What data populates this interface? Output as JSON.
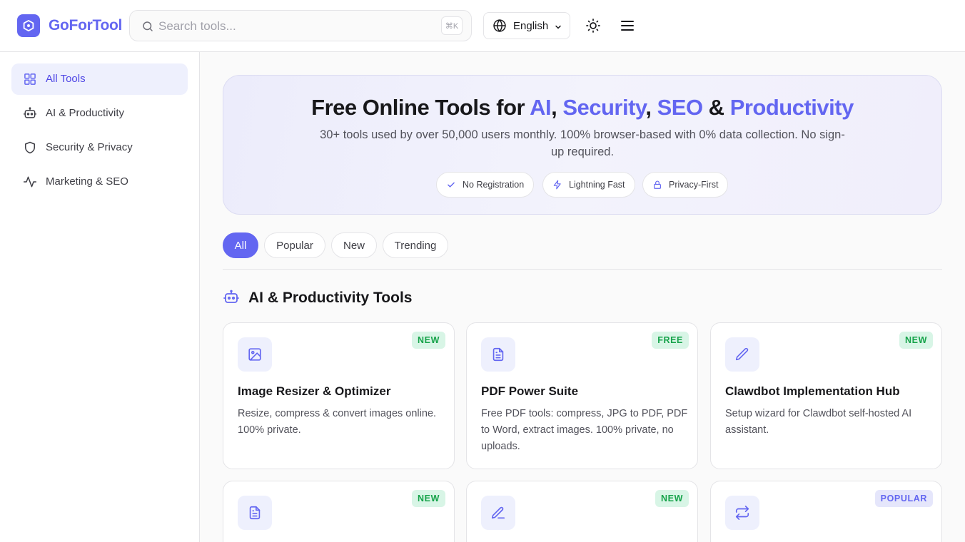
{
  "brand": {
    "name": "GoForTool",
    "accent": "#6366f1"
  },
  "header": {
    "search_placeholder": "Search tools...",
    "search_shortcut": "⌘K",
    "language": "English"
  },
  "sidebar": {
    "items": [
      {
        "label": "All Tools",
        "icon": "grid-icon",
        "active": true
      },
      {
        "label": "AI & Productivity",
        "icon": "robot-icon",
        "active": false
      },
      {
        "label": "Security & Privacy",
        "icon": "shield-icon",
        "active": false
      },
      {
        "label": "Marketing & SEO",
        "icon": "activity-icon",
        "active": false
      }
    ]
  },
  "hero": {
    "title_prefix": "Free Online Tools for ",
    "title_ai": "AI",
    "title_security": "Security",
    "title_seo": "SEO",
    "title_productivity": "Productivity",
    "subtitle": "30+ tools used by over 50,000 users monthly. 100% browser-based with 0% data collection. No sign-up required.",
    "pills": [
      {
        "label": "No Registration",
        "icon": "check-icon"
      },
      {
        "label": "Lightning Fast",
        "icon": "lightning-icon"
      },
      {
        "label": "Privacy-First",
        "icon": "lock-icon"
      }
    ]
  },
  "filters": [
    "All",
    "Popular",
    "New",
    "Trending"
  ],
  "active_filter": "All",
  "section": {
    "title": "AI & Productivity Tools",
    "icon": "robot-icon"
  },
  "cards": [
    {
      "title": "Image Resizer & Optimizer",
      "desc": "Resize, compress & convert images online. 100% private.",
      "badge": "NEW",
      "icon": "image-icon"
    },
    {
      "title": "PDF Power Suite",
      "desc": "Free PDF tools: compress, JPG to PDF, PDF to Word, extract images. 100% private, no uploads.",
      "badge": "FREE",
      "icon": "file-text-icon"
    },
    {
      "title": "Clawdbot Implementation Hub",
      "desc": "Setup wizard for Clawdbot self-hosted AI assistant.",
      "badge": "NEW",
      "icon": "pencil-icon"
    },
    {
      "title": "",
      "desc": "",
      "badge": "NEW",
      "icon": "file-text-icon"
    },
    {
      "title": "",
      "desc": "",
      "badge": "NEW",
      "icon": "pen-line-icon"
    },
    {
      "title": "",
      "desc": "",
      "badge": "POPULAR",
      "icon": "repeat-icon"
    }
  ]
}
